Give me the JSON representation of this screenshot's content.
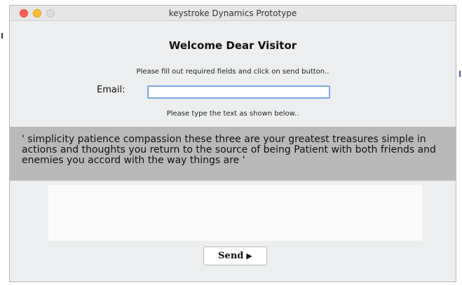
{
  "window": {
    "title": "keystroke Dynamics Prototype"
  },
  "form": {
    "welcome": "Welcome Dear Visitor",
    "instructions": "Please fill out required fields and click on send button..",
    "email_label": "Email:",
    "email_value": "",
    "type_text_label": "Please type the text as shown below..",
    "sample_text": "'   simplicity patience compassion these three are your greatest treasures simple in actions and thoughts you return to the source of being Patient with both friends and enemies you accord with the way things are  '",
    "typing_value": "",
    "send_label": "Send",
    "send_icon": "play-triangle"
  },
  "colors": {
    "window_background": "#eceeef",
    "sample_panel": "#b9b9b9",
    "input_focus_border": "#7aa7e0",
    "close": "#fc5f57",
    "minimize": "#fdbc2e",
    "zoom": "#dcdcdc"
  }
}
